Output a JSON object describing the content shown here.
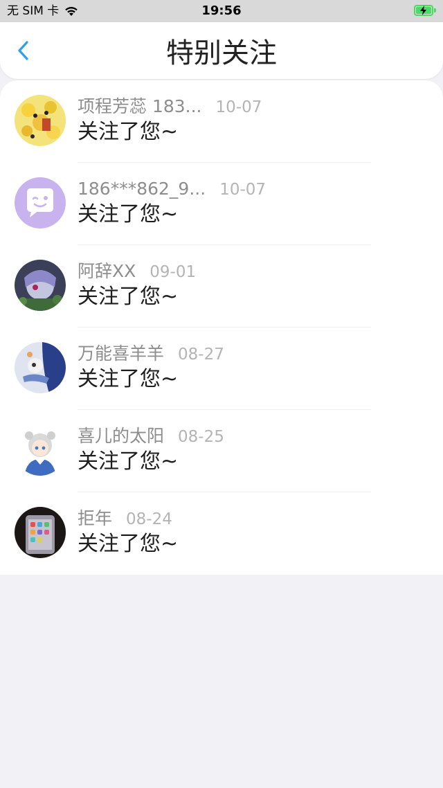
{
  "status_bar": {
    "carrier": "无 SIM 卡",
    "time": "19:56"
  },
  "nav": {
    "title": "特别关注"
  },
  "items": [
    {
      "name": "项程芳蕊 183...",
      "date": "10-07",
      "message": "关注了您~"
    },
    {
      "name": "186***862_9...",
      "date": "10-07",
      "message": "关注了您~"
    },
    {
      "name": "阿辞XX",
      "date": "09-01",
      "message": "关注了您~"
    },
    {
      "name": "万能喜羊羊",
      "date": "08-27",
      "message": "关注了您~"
    },
    {
      "name": "喜儿的太阳",
      "date": "08-25",
      "message": "关注了您~"
    },
    {
      "name": "拒年",
      "date": "08-24",
      "message": "关注了您~"
    }
  ],
  "colors": {
    "accent": "#2b9ff0",
    "battery": "#4cd964",
    "background": "#f2f1f6"
  },
  "icons": {
    "back": "chevron-left-icon",
    "wifi": "wifi-icon",
    "battery": "battery-charging-icon"
  }
}
